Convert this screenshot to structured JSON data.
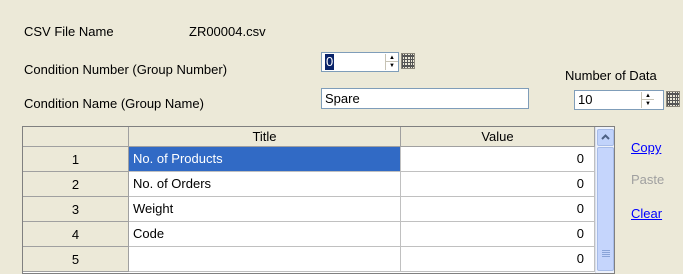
{
  "file": {
    "label": "CSV File Name",
    "value": "ZR00004.csv"
  },
  "condition_number": {
    "label": "Condition Number (Group Number)",
    "value": "0"
  },
  "condition_name": {
    "label": "Condition Name (Group Name)",
    "value": "Spare"
  },
  "number_of_data": {
    "label": "Number of Data",
    "value": "10"
  },
  "grid": {
    "headers": {
      "title": "Title",
      "value": "Value"
    },
    "rows": [
      {
        "num": "1",
        "title": "No. of Products",
        "value": "0"
      },
      {
        "num": "2",
        "title": "No. of Orders",
        "value": "0"
      },
      {
        "num": "3",
        "title": "Weight",
        "value": "0"
      },
      {
        "num": "4",
        "title": "Code",
        "value": "0"
      },
      {
        "num": "5",
        "title": "",
        "value": "0"
      }
    ],
    "selected_row": 1
  },
  "actions": {
    "copy": "Copy",
    "paste": "Paste",
    "clear": "Clear"
  },
  "colors": {
    "accent": "#316ac5",
    "link": "#0000ff",
    "window": "#ece9d8"
  },
  "icons": {
    "spin_up": "triangle-up-icon",
    "spin_down": "triangle-down-icon",
    "keypad": "keypad-icon",
    "scroll_up": "chevron-up-icon"
  }
}
